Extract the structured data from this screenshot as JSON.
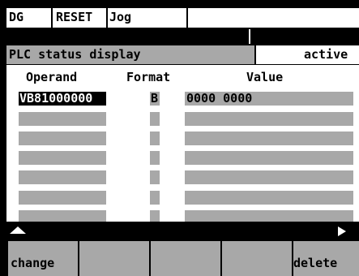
{
  "header": {
    "area": "DG",
    "channel": "RESET",
    "mode": "Jog",
    "message": ""
  },
  "status_bar": {
    "title": "PLC status display",
    "state": "active"
  },
  "table": {
    "columns": [
      "Operand",
      "Format",
      "Value"
    ],
    "rows": [
      {
        "operand": "VB81000000",
        "format": "B",
        "value": "0000 0000"
      },
      {
        "operand": "",
        "format": "",
        "value": ""
      },
      {
        "operand": "",
        "format": "",
        "value": ""
      },
      {
        "operand": "",
        "format": "",
        "value": ""
      },
      {
        "operand": "",
        "format": "",
        "value": ""
      },
      {
        "operand": "",
        "format": "",
        "value": ""
      },
      {
        "operand": "",
        "format": "",
        "value": ""
      }
    ]
  },
  "nav": {
    "back_icon": "triangle-up-icon",
    "forward_icon": "triangle-right-icon"
  },
  "softkeys": [
    "change",
    "",
    "",
    "",
    "delete"
  ],
  "colors": {
    "panel_gray": "#a8a8a8",
    "background": "#000000",
    "highlight": "#ffffff",
    "selected_cell": "#000000"
  }
}
